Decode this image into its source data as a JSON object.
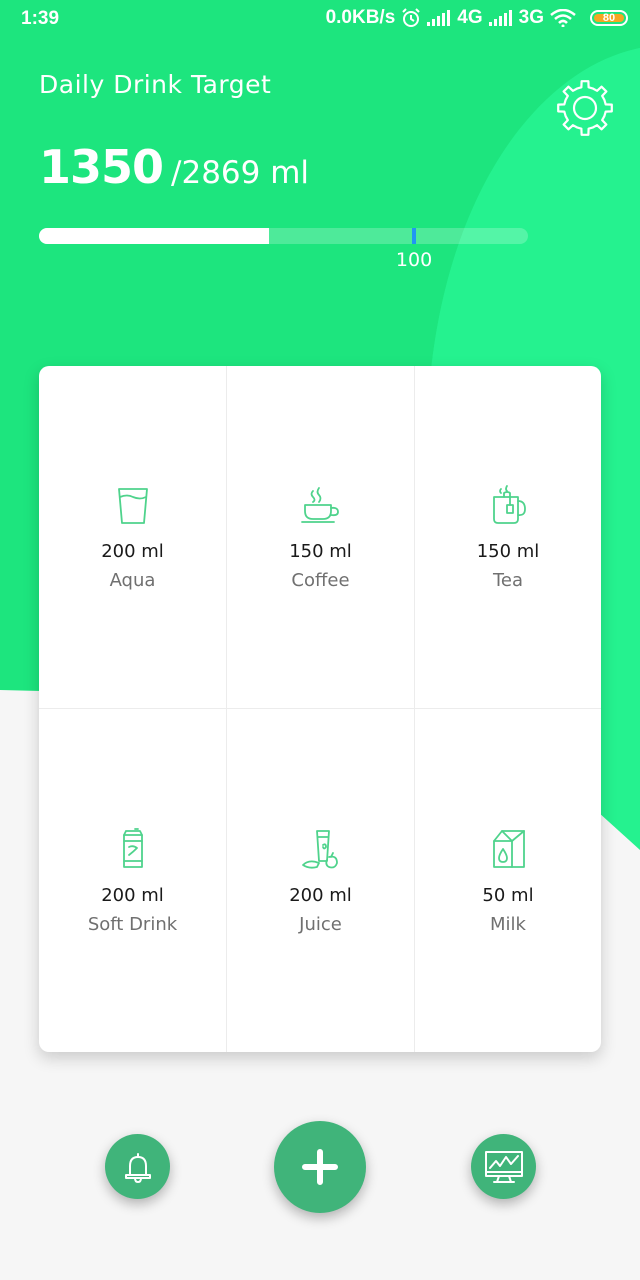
{
  "status_bar": {
    "time": "1:39",
    "network_speed": "0.0KB/s",
    "network_4g": "4G",
    "network_3g": "3G",
    "battery": "80",
    "icons": [
      "alarm-icon",
      "signal-icon",
      "wifi-icon",
      "battery-icon"
    ]
  },
  "header": {
    "title": "Daily Drink Target",
    "current_amount": "1350",
    "target_amount": "/2869 ml",
    "progress_fraction": 0.47,
    "marker_fraction": 0.767,
    "marker_label": "100",
    "settings_icon": "gear-icon"
  },
  "drinks": [
    {
      "amount": "200 ml",
      "name": "Aqua",
      "icon": "glass-icon"
    },
    {
      "amount": "150 ml",
      "name": "Coffee",
      "icon": "coffee-cup-icon"
    },
    {
      "amount": "150 ml",
      "name": "Tea",
      "icon": "tea-mug-icon"
    },
    {
      "amount": "200 ml",
      "name": "Soft Drink",
      "icon": "soda-can-icon"
    },
    {
      "amount": "200 ml",
      "name": "Juice",
      "icon": "juice-icon"
    },
    {
      "amount": "50 ml",
      "name": "Milk",
      "icon": "milk-carton-icon"
    }
  ],
  "actions": {
    "reminder_icon": "bell-icon",
    "add_icon": "plus-icon",
    "stats_icon": "chart-monitor-icon"
  },
  "colors": {
    "accent": "#1de57e",
    "accent_light": "#25f28f",
    "button": "#40b47a",
    "icon_line": "#4fd38c",
    "marker": "#2196f3",
    "background": "#f6f6f6"
  }
}
